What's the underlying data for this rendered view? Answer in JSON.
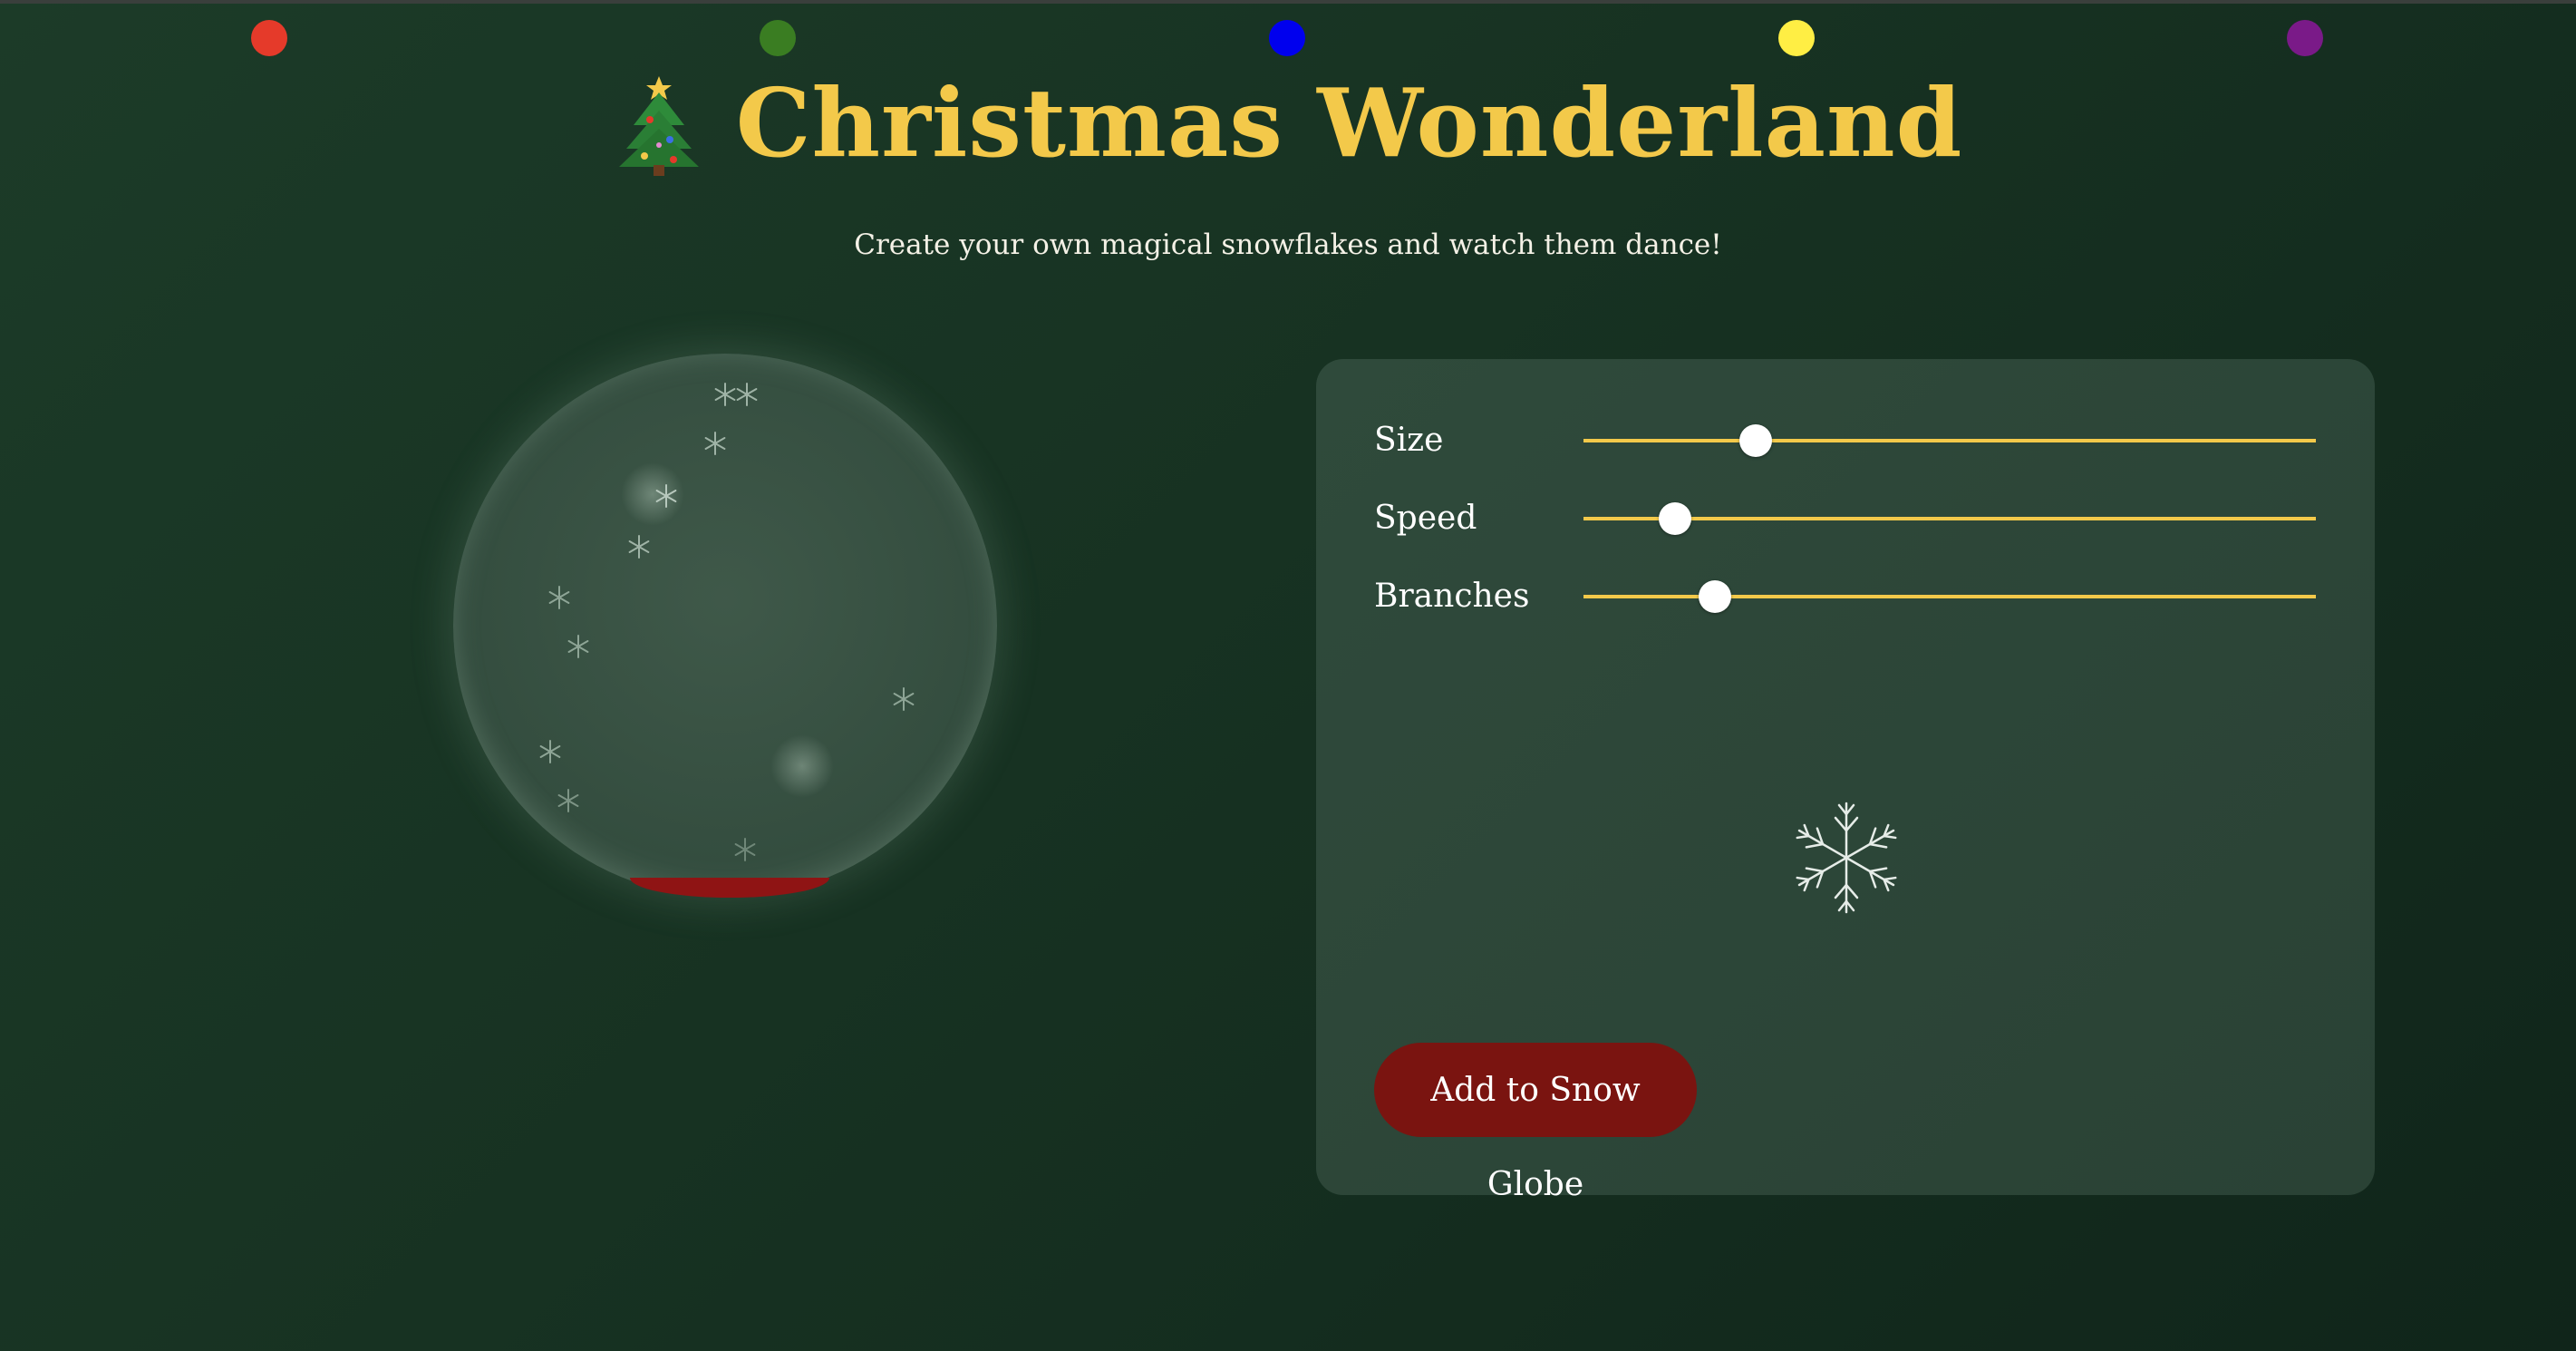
{
  "header": {
    "title": "Christmas Wonderland",
    "subtitle": "Create your own magical snowflakes and watch them dance!",
    "tree_icon": "christmas-tree-icon"
  },
  "lights": {
    "colors": [
      "#e53a2a",
      "#3a7d22",
      "#0000ee",
      "#ffee44",
      "#7a1a88"
    ]
  },
  "controls": {
    "size": {
      "label": "Size",
      "value": 0.235
    },
    "speed": {
      "label": "Speed",
      "value": 0.125
    },
    "branches": {
      "label": "Branches",
      "value": 0.18
    }
  },
  "actions": {
    "add_label": "Add to Snow Globe"
  },
  "colors": {
    "accent": "#f3c94a",
    "button": "#7a1410",
    "globe_base": "#8f1414"
  }
}
